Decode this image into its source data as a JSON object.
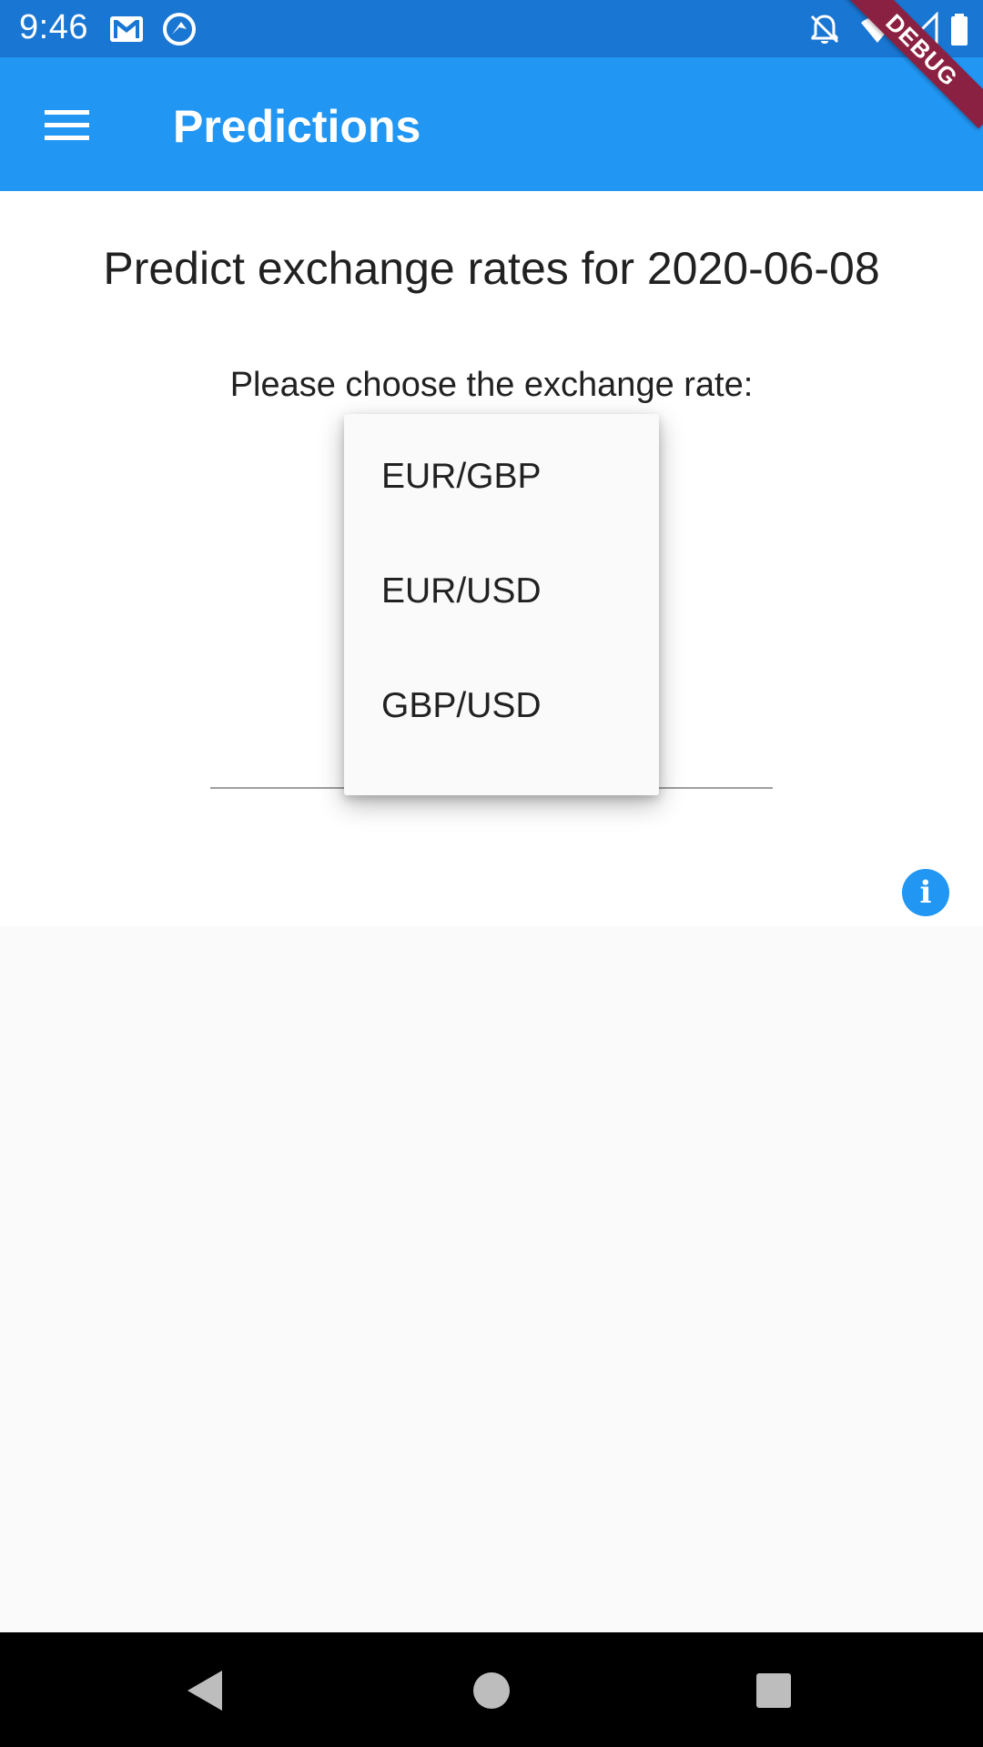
{
  "status_bar": {
    "time": "9:46",
    "icons": [
      "gmail-icon",
      "assistant-icon",
      "notifications-off-icon",
      "wifi-icon",
      "signal-icon",
      "battery-icon"
    ]
  },
  "debug_banner": "DEBUG",
  "app_bar": {
    "title": "Predictions",
    "menu_icon": "menu-icon"
  },
  "main": {
    "heading": "Predict exchange rates for 2020-06-08",
    "prompt": "Please choose the exchange rate:"
  },
  "dropdown": {
    "options": [
      "EUR/GBP",
      "EUR/USD",
      "GBP/USD"
    ]
  },
  "info_button": {
    "glyph": "i",
    "icon": "info-icon"
  },
  "nav_bar": {
    "icons": [
      "back-icon",
      "home-icon",
      "recents-icon"
    ]
  },
  "colors": {
    "primary": "#2196f3",
    "primary_dark": "#1976d2",
    "debug_banner": "#8b2142"
  }
}
